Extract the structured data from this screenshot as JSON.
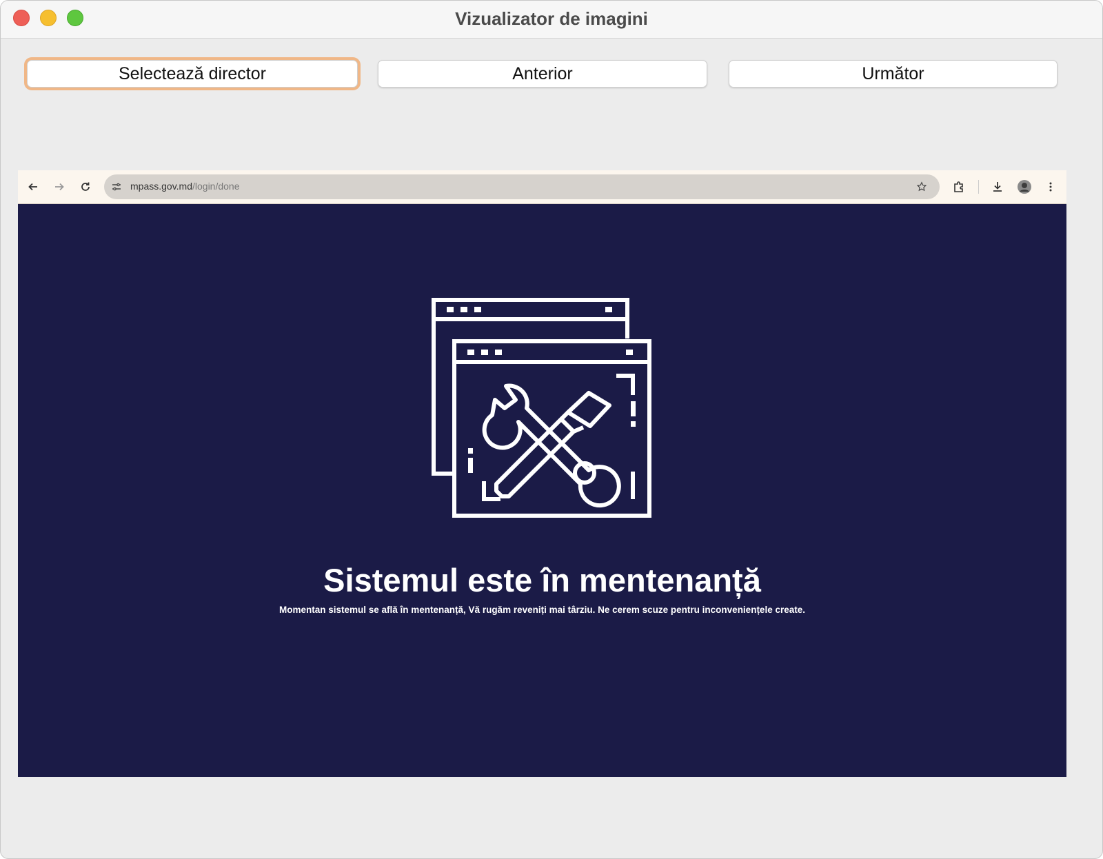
{
  "window": {
    "title": "Vizualizator de imagini"
  },
  "toolbar": {
    "select_label": "Selectează director",
    "prev_label": "Anterior",
    "next_label": "Următor"
  },
  "browser": {
    "url_domain": "mpass.gov.md",
    "url_path": "/login/done",
    "icons": [
      "back-icon",
      "forward-icon",
      "reload-icon",
      "site-settings-icon",
      "bookmark-star-icon",
      "extensions-icon",
      "download-icon",
      "avatar",
      "menu-icon"
    ]
  },
  "page": {
    "heading": "Sistemul este în mentenanță",
    "message": "Momentan sistemul se află în mentenanță, Vă rugăm reveniți mai târziu. Ne cerem scuze pentru inconveniențele create.",
    "illustration": "maintenance-tools-icon",
    "background_color": "#1b1b47"
  }
}
